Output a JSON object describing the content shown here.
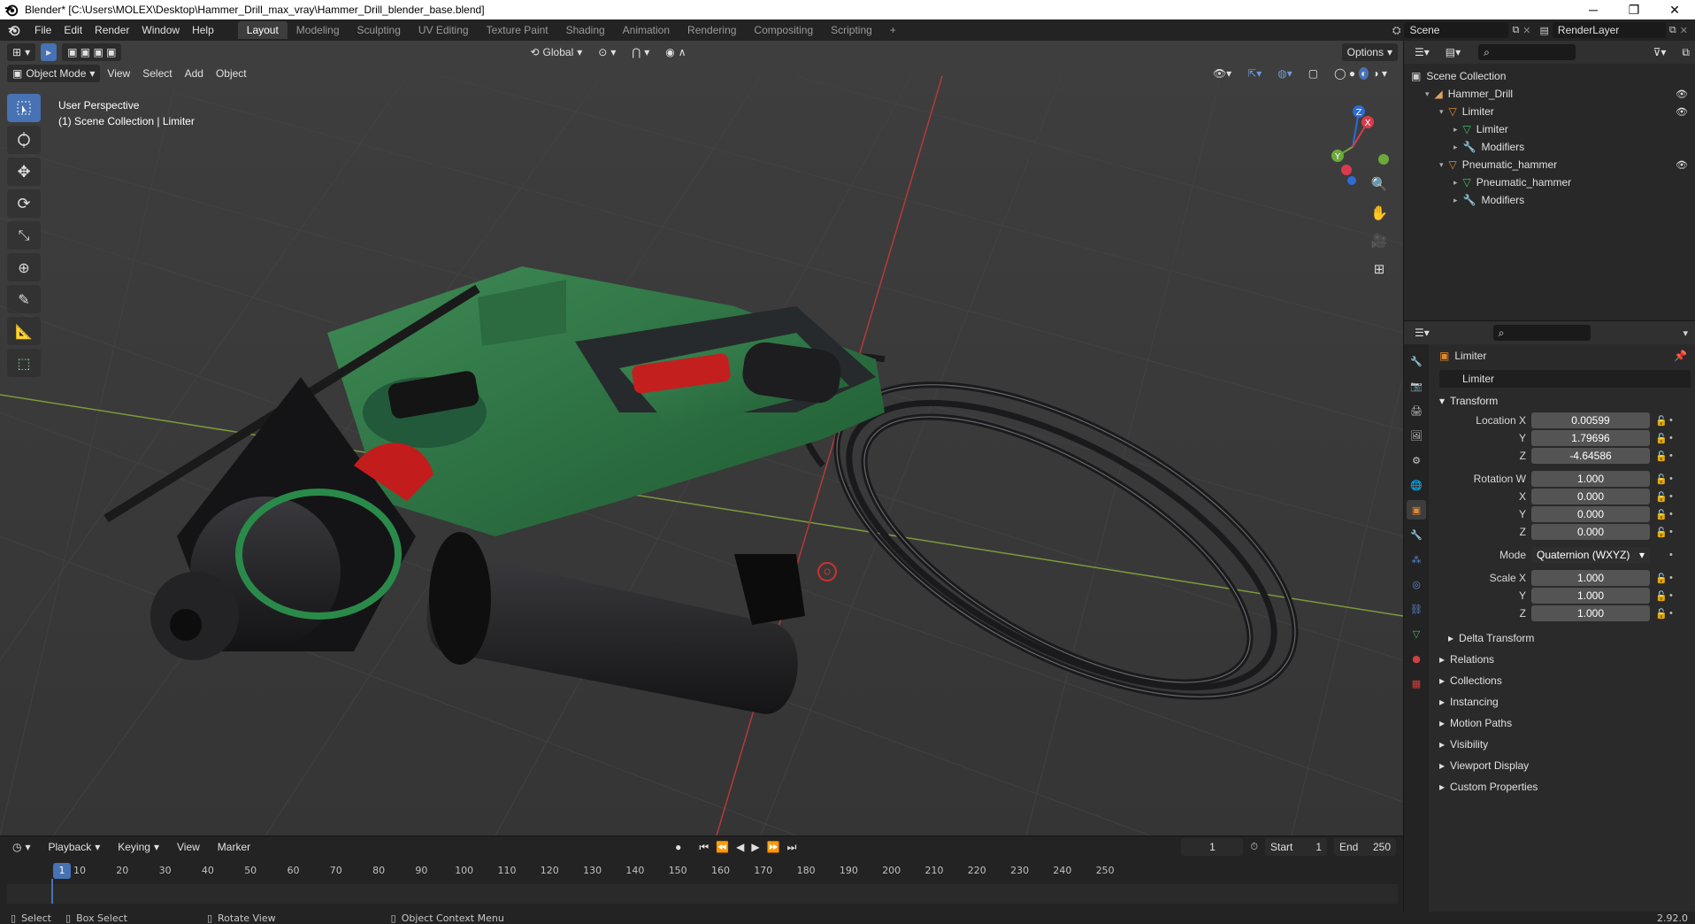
{
  "window": {
    "title": "Blender* [C:\\Users\\MOLEX\\Desktop\\Hammer_Drill_max_vray\\Hammer_Drill_blender_base.blend]",
    "minimize": "─",
    "maximize": "❐",
    "close": "✕"
  },
  "menus": [
    "File",
    "Edit",
    "Render",
    "Window",
    "Help"
  ],
  "workspaces": [
    "Layout",
    "Modeling",
    "Sculpting",
    "UV Editing",
    "Texture Paint",
    "Shading",
    "Animation",
    "Rendering",
    "Compositing",
    "Scripting"
  ],
  "add_workspace": "+",
  "scene": {
    "name": "Scene",
    "render_layer": "RenderLayer"
  },
  "viewport": {
    "mode": "Object Mode",
    "menus": [
      "View",
      "Select",
      "Add",
      "Object"
    ],
    "orientation": "Global",
    "options": "Options",
    "perspective": "User Perspective",
    "context": "(1) Scene Collection | Limiter",
    "gizmo": {
      "x": "X",
      "y": "Y",
      "z": "Z"
    }
  },
  "outliner": {
    "root": "Scene Collection",
    "items": [
      {
        "label": "Hammer_Drill",
        "depth": 1,
        "icon": "collection-icon",
        "eye": true
      },
      {
        "label": "Limiter",
        "depth": 2,
        "icon": "object-icon",
        "eye": true
      },
      {
        "label": "Limiter",
        "depth": 3,
        "icon": "mesh-icon",
        "eye": false
      },
      {
        "label": "Modifiers",
        "depth": 3,
        "icon": "wrench-icon",
        "eye": false
      },
      {
        "label": "Pneumatic_hammer",
        "depth": 2,
        "icon": "object-icon",
        "eye": true
      },
      {
        "label": "Pneumatic_hammer",
        "depth": 3,
        "icon": "mesh-icon",
        "eye": false
      },
      {
        "label": "Modifiers",
        "depth": 3,
        "icon": "wrench-icon",
        "eye": false
      }
    ]
  },
  "properties": {
    "object_name": "Limiter",
    "object_field": "Limiter",
    "transform_title": "Transform",
    "location": {
      "label_x": "Location X",
      "label_y": "Y",
      "label_z": "Z",
      "x": "0.00599",
      "y": "1.79696",
      "z": "-4.64586"
    },
    "rotation": {
      "label_w": "Rotation W",
      "label_x": "X",
      "label_y": "Y",
      "label_z": "Z",
      "w": "1.000",
      "x": "0.000",
      "y": "0.000",
      "z": "0.000"
    },
    "mode": {
      "label": "Mode",
      "value": "Quaternion (WXYZ)"
    },
    "scale": {
      "label_x": "Scale X",
      "label_y": "Y",
      "label_z": "Z",
      "x": "1.000",
      "y": "1.000",
      "z": "1.000"
    },
    "delta": "Delta Transform",
    "panels": [
      "Relations",
      "Collections",
      "Instancing",
      "Motion Paths",
      "Visibility",
      "Viewport Display",
      "Custom Properties"
    ]
  },
  "timeline": {
    "menus": [
      "Playback",
      "Keying",
      "View",
      "Marker"
    ],
    "current_frame": "1",
    "start_label": "Start",
    "start": "1",
    "end_label": "End",
    "end": "250",
    "ticks": [
      "10",
      "20",
      "30",
      "40",
      "50",
      "60",
      "70",
      "80",
      "90",
      "100",
      "110",
      "120",
      "130",
      "140",
      "150",
      "160",
      "170",
      "180",
      "190",
      "200",
      "210",
      "220",
      "230",
      "240",
      "250"
    ]
  },
  "status": {
    "select": "Select",
    "box_select": "Box Select",
    "rotate_view": "Rotate View",
    "context_menu": "Object Context Menu",
    "version": "2.92.0"
  }
}
